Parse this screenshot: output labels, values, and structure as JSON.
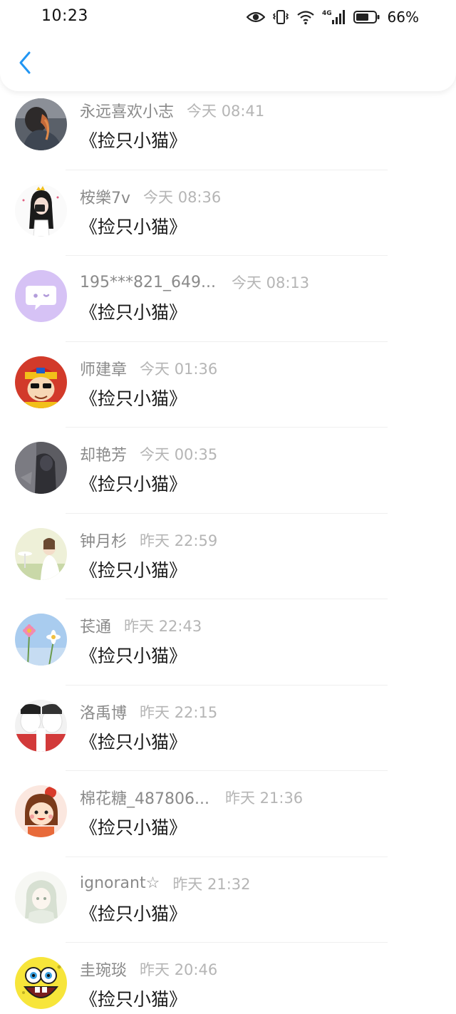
{
  "status_bar": {
    "time": "10:23",
    "network": "4G",
    "battery": "66%"
  },
  "header": {
    "back_icon": "chevron-left-icon",
    "accent_color": "#2196f3"
  },
  "comments": [
    {
      "name": "永远喜欢小志",
      "time": "今天 08:41",
      "title": "《捡只小猫》"
    },
    {
      "name": "桉樂7v",
      "time": "今天 08:36",
      "title": "《捡只小猫》"
    },
    {
      "name": "195***821_649...",
      "time": "今天 08:13",
      "title": "《捡只小猫》"
    },
    {
      "name": "师建章",
      "time": "今天 01:36",
      "title": "《捡只小猫》"
    },
    {
      "name": "却艳芳",
      "time": "今天 00:35",
      "title": "《捡只小猫》"
    },
    {
      "name": "钟月杉",
      "time": "昨天 22:59",
      "title": "《捡只小猫》"
    },
    {
      "name": "苌通",
      "time": "昨天 22:43",
      "title": "《捡只小猫》"
    },
    {
      "name": "洛禹博",
      "time": "昨天 22:15",
      "title": "《捡只小猫》"
    },
    {
      "name": "棉花糖_487806...",
      "time": "昨天 21:36",
      "title": "《捡只小猫》"
    },
    {
      "name": "ignorant☆",
      "time": "昨天 21:32",
      "title": "《捡只小猫》"
    },
    {
      "name": "圭琬琰",
      "time": "昨天 20:46",
      "title": "《捡只小猫》"
    }
  ]
}
